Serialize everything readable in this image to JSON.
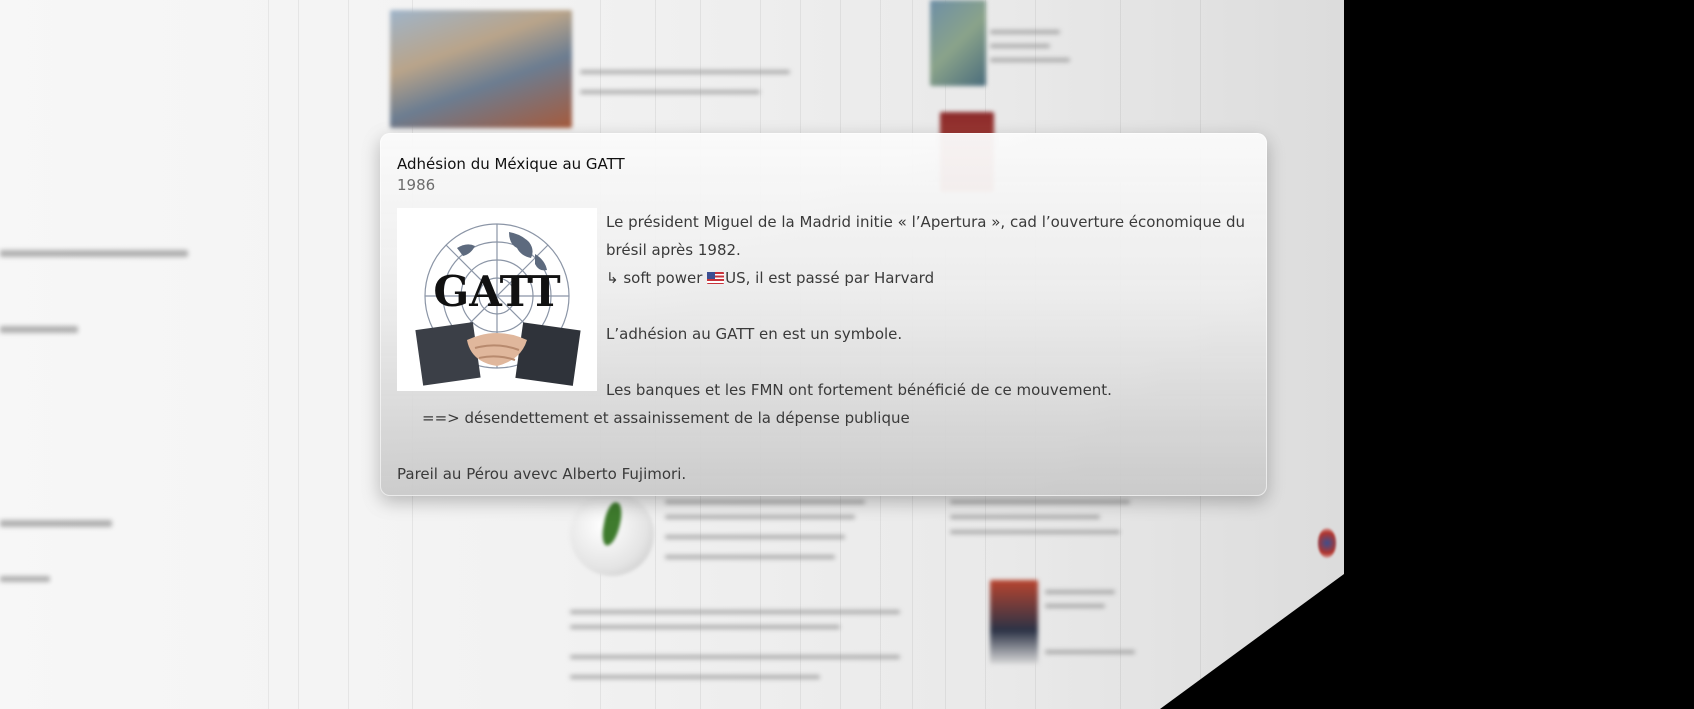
{
  "event": {
    "title": "Adhésion du Méxique au GATT",
    "year": "1986",
    "image": {
      "logo_text": "GATT",
      "icon": "gatt-logo-handshake"
    },
    "lines": {
      "l1": "Le président Miguel de la Madrid initie « l’Apertura », cad l’ouverture économique du brésil après 1982.",
      "l2_prefix": "↳ soft power ",
      "l2_flag_icon": "us-flag-emoji",
      "l2_suffix": "US, il est passé par Harvard",
      "l3": "L’adhésion au GATT en est un symbole.",
      "l4": "Les banques et les FMN ont fortement bénéficié de ce mouvement.",
      "l5": "==> désendettement et assainissement de la dépense publique",
      "l6": "Pareil au Pérou avevc Alberto Fujimori."
    }
  },
  "colors": {
    "card_top": "#fafafa",
    "card_bottom": "#c8c8c8",
    "title_text": "#111111",
    "year_text": "#6c6c6c",
    "body_text": "#3a3a3a",
    "outer_background": "#000000"
  }
}
